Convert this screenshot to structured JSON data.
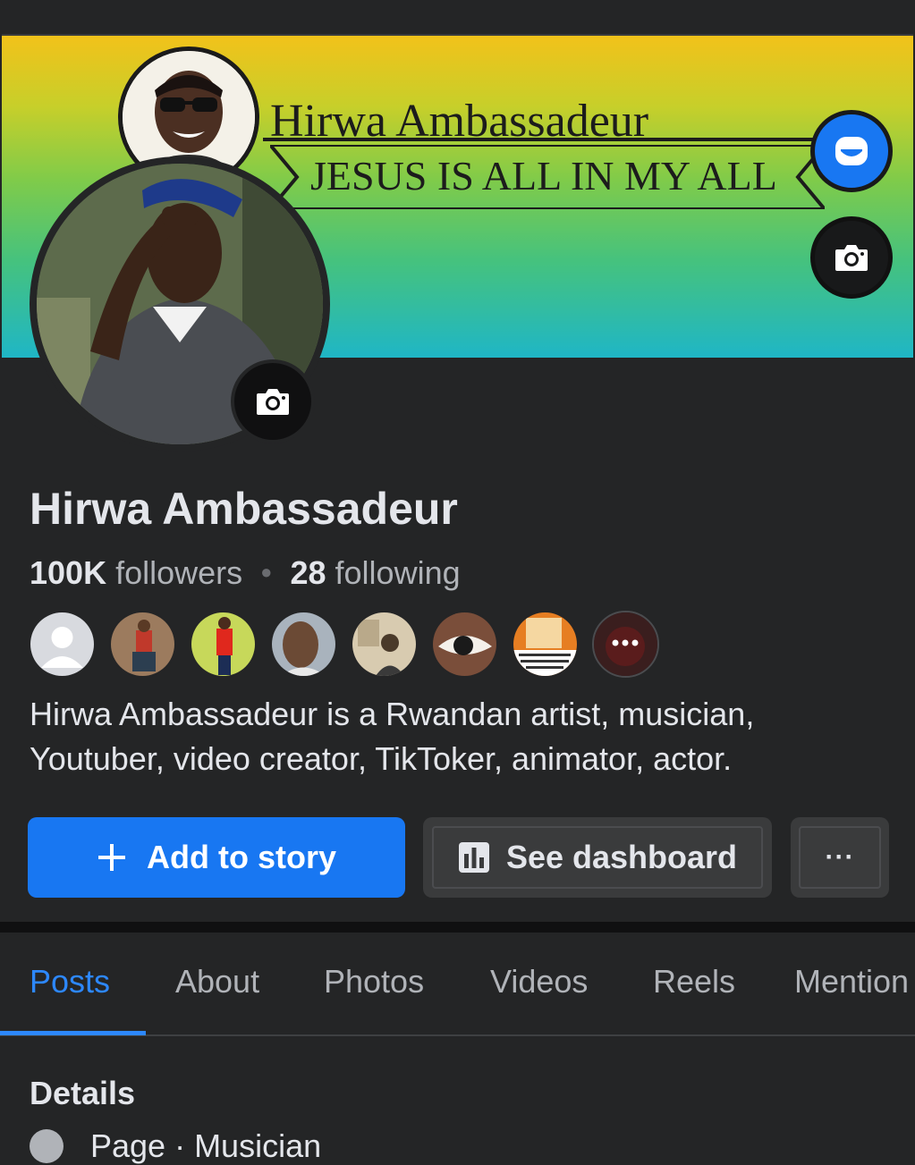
{
  "cover": {
    "title": "Hirwa Ambassadeur",
    "ribbon": "JESUS IS ALL IN MY ALL"
  },
  "icons": {
    "avatar_edit": "message-face-icon",
    "cover_camera": "camera-icon",
    "profile_camera": "camera-icon",
    "add": "plus-icon",
    "dashboard": "bar-chart-icon",
    "more": "more-icon"
  },
  "profile": {
    "name": "Hirwa Ambassadeur",
    "followers_count": "100K",
    "followers_label": "followers",
    "following_count": "28",
    "following_label": "following",
    "bio": "Hirwa Ambassadeur is a Rwandan artist, musician, Youtuber, video creator, TikToker, animator, actor."
  },
  "actions": {
    "add_story": "Add to story",
    "see_dashboard": "See dashboard",
    "more": "···"
  },
  "tabs": [
    "Posts",
    "About",
    "Photos",
    "Videos",
    "Reels",
    "Mention"
  ],
  "details": {
    "heading": "Details",
    "first_item": "Page · Musician"
  },
  "colors": {
    "accent": "#1877f2",
    "active_tab": "#2d88ff",
    "background": "#242526"
  }
}
